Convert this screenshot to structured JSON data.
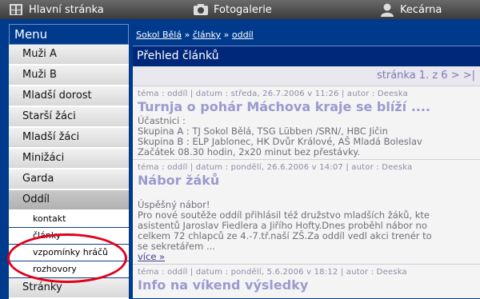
{
  "topbar": {
    "items": [
      {
        "label": "Hlavní stránka",
        "icon": "home-icon"
      },
      {
        "label": "Fotogalerie",
        "icon": "camera-icon"
      },
      {
        "label": "Kecárna",
        "icon": "chat-icon"
      }
    ]
  },
  "sidebar": {
    "title": "Menu",
    "items": [
      {
        "label": "Muži A"
      },
      {
        "label": "Muži B"
      },
      {
        "label": "Mladší dorost"
      },
      {
        "label": "Starší žáci"
      },
      {
        "label": "Mladší žáci"
      },
      {
        "label": "Minižáci"
      },
      {
        "label": "Garda"
      },
      {
        "label": "Oddíl"
      }
    ],
    "subitems": [
      {
        "label": "kontakt"
      },
      {
        "label": "články"
      },
      {
        "label": "vzpomínky hráčů"
      },
      {
        "label": "rozhovory"
      }
    ],
    "after": [
      {
        "label": "Stránky"
      }
    ]
  },
  "breadcrumb": {
    "a": "Sokol Bělá",
    "sep1": "»",
    "b": "články",
    "sep2": "»",
    "c": "oddíl"
  },
  "main": {
    "heading": "Přehled článků",
    "pager": "stránka 1. z 6 > >|",
    "articles": [
      {
        "meta": "téma : oddíl | datum : středa, 26.7.2006 v 11:26 | autor : Deeska",
        "title": "Turnja o pohár Máchova kraje se blíží ....",
        "body": "Účastnici :\nSkupina A : TJ Sokol Bělá, TSG Lübben /SRN/, HBC Jičin\nSkupina B : ELP Jablonec, HK Dvůr Králové, AŠ Mladá Boleslav\nZačátek 08.30 hodin, 2x20 minut bez přestávky."
      },
      {
        "meta": "téma : oddíl | datum : pondělí, 26.6.2006 v 14:07 | autor : Deeska",
        "title": "Nábor žáků",
        "body": "Úspěšný nábor!\nPro nové soutěže oddíl přihlásil též družstvo mladších žáků, kte\nasistentů Jaroslav Fiedlera a Jiřího Hofty.Dnes proběhl nábor no\ncelkem 72 chlapců ze 4.-7.tř.naší ZŠ.Za oddíl vedl akci trenér to\nse sekretářem ...",
        "more": "více »"
      },
      {
        "meta": "téma : oddíl | datum : pondělí, 5.6.2006 v 18:12 | autor : Deeska",
        "title": "Info na víkend výsledky"
      }
    ]
  }
}
